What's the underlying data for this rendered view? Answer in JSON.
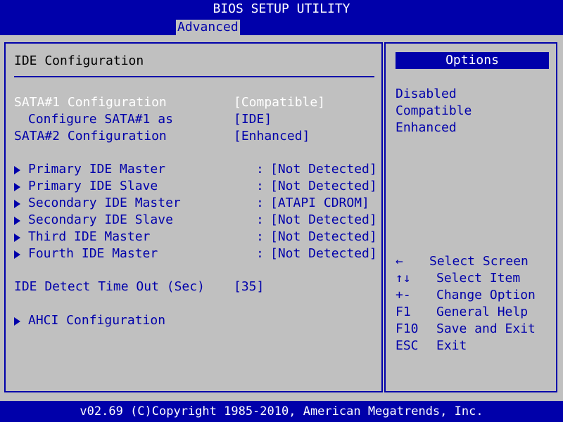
{
  "header": {
    "title": "BIOS SETUP UTILITY",
    "active_tab": "Advanced"
  },
  "left_panel": {
    "title": "IDE Configuration",
    "settings": [
      {
        "label": "SATA#1 Configuration",
        "value": "[Compatible]",
        "selected": true
      },
      {
        "label": "Configure SATA#1 as",
        "value": "[IDE]"
      },
      {
        "label": "SATA#2 Configuration",
        "value": "[Enhanced]"
      }
    ],
    "devices": [
      {
        "label": "Primary IDE Master",
        "separator": ":",
        "value": "[Not Detected]"
      },
      {
        "label": "Primary IDE Slave",
        "separator": ":",
        "value": "[Not Detected]"
      },
      {
        "label": "Secondary IDE Master",
        "separator": ":",
        "value": "[ATAPI CDROM]"
      },
      {
        "label": "Secondary IDE Slave",
        "separator": ":",
        "value": "[Not Detected]"
      },
      {
        "label": "Third IDE Master",
        "separator": ":",
        "value": "[Not Detected]"
      },
      {
        "label": "Fourth IDE Master",
        "separator": ":",
        "value": "[Not Detected]"
      }
    ],
    "timeout": {
      "label": "IDE Detect Time Out (Sec)",
      "value": "[35]"
    },
    "ahci": {
      "label": "AHCI Configuration"
    }
  },
  "right_panel": {
    "header": "Options",
    "options": [
      "Disabled",
      "Compatible",
      "Enhanced"
    ],
    "help": [
      {
        "key": "←",
        "desc": "Select Screen"
      },
      {
        "key": "↑↓",
        "desc": "Select Item"
      },
      {
        "key": "+-",
        "desc": "Change Option"
      },
      {
        "key": "F1",
        "desc": "General Help"
      },
      {
        "key": "F10",
        "desc": "Save and Exit"
      },
      {
        "key": "ESC",
        "desc": "Exit"
      }
    ]
  },
  "footer": {
    "text": "v02.69 (C)Copyright 1985-2010, American Megatrends, Inc."
  },
  "colors": {
    "bios_blue": "#0000aa",
    "panel_gray": "#c0c0c0",
    "highlight_white": "#ffffff"
  }
}
